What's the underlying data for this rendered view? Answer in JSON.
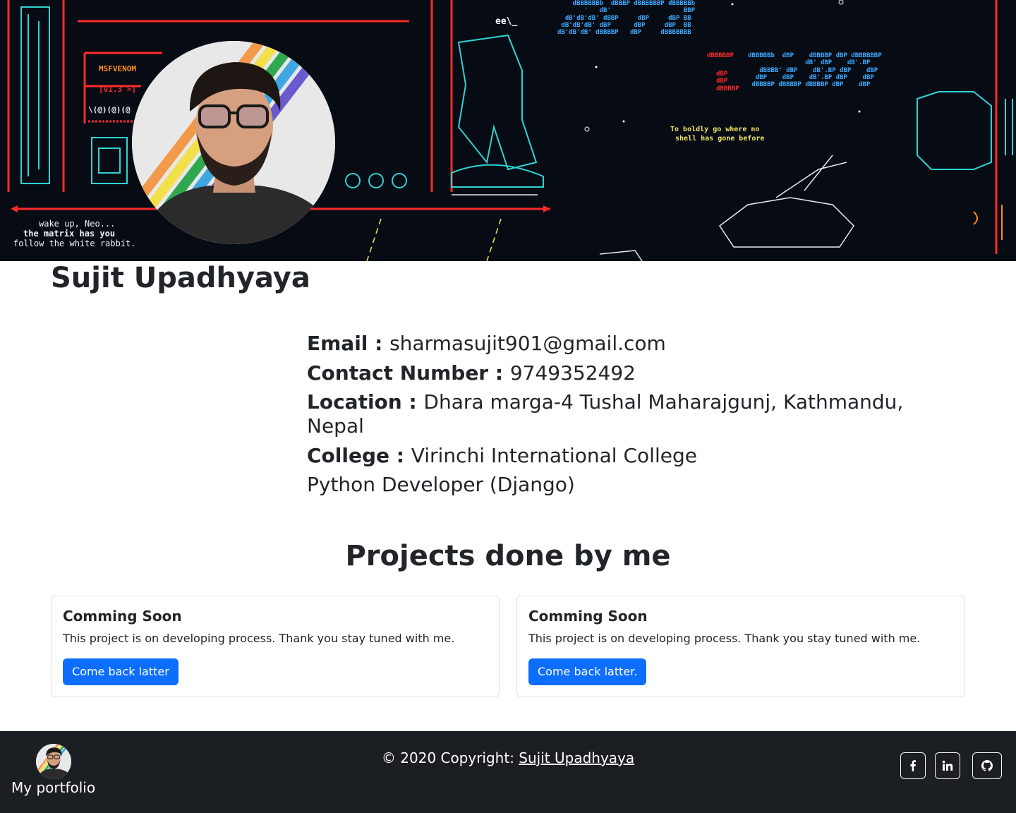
{
  "profile": {
    "name": "Sujit Upadhyaya",
    "email_label": "Email : ",
    "email": "sharmasujit901@gmail.com",
    "contact_label": "Contact Number : ",
    "contact": "9749352492",
    "location_label": "Location : ",
    "location": "Dhara marga-4 Tushal Maharajgunj, Kathmandu, Nepal",
    "college_label": "College : ",
    "college": "Virinchi International College",
    "role": "Python Developer (Django)"
  },
  "banner": {
    "msf": "MSFVENOM",
    "version": "[v1.3 >]",
    "neo_line1": "wake up, Neo...",
    "neo_line2": "the matrix has you",
    "neo_line3": "follow the white rabbit.",
    "shell_line1": "To boldly go where no",
    "shell_line2": "shell has gone before"
  },
  "projects": {
    "title": "Projects done by me",
    "cards": [
      {
        "title": "Comming Soon",
        "text": "This project is on developing process. Thank you stay tuned with me.",
        "button": "Come back latter"
      },
      {
        "title": "Comming Soon",
        "text": "This project is on developing process. Thank you stay tuned with me.",
        "button": "Come back latter."
      }
    ]
  },
  "footer": {
    "brand": "My portfolio",
    "copyright_prefix": "© 2020 Copyright: ",
    "copyright_name": "Sujit Upadhyaya",
    "social_icons": [
      "facebook-icon",
      "linkedin-icon",
      "github-icon"
    ]
  },
  "colors": {
    "primary": "#0d6efd",
    "footer_bg": "#1b1f23",
    "banner_bg": "#070b14"
  }
}
